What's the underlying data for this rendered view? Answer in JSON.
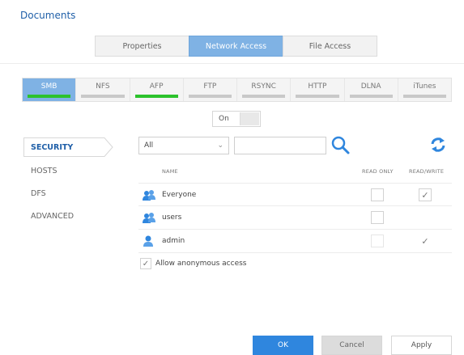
{
  "page": {
    "title": "Documents"
  },
  "main_tabs": [
    {
      "label": "Properties",
      "active": false
    },
    {
      "label": "Network Access",
      "active": true
    },
    {
      "label": "File Access",
      "active": false
    }
  ],
  "protocol_tabs": [
    {
      "label": "SMB",
      "active": true,
      "enabled": true
    },
    {
      "label": "NFS",
      "active": false,
      "enabled": false
    },
    {
      "label": "AFP",
      "active": false,
      "enabled": true
    },
    {
      "label": "FTP",
      "active": false,
      "enabled": false
    },
    {
      "label": "RSYNC",
      "active": false,
      "enabled": false
    },
    {
      "label": "HTTP",
      "active": false,
      "enabled": false
    },
    {
      "label": "DLNA",
      "active": false,
      "enabled": false
    },
    {
      "label": "iTunes",
      "active": false,
      "enabled": false
    }
  ],
  "toggle": {
    "label": "On"
  },
  "nav": {
    "security": "SECURITY",
    "hosts": "HOSTS",
    "dfs": "DFS",
    "advanced": "ADVANCED"
  },
  "filter": {
    "selected": "All",
    "search_value": ""
  },
  "table": {
    "headers": {
      "name": "NAME",
      "read_only": "READ ONLY",
      "read_write": "READ/WRITE"
    },
    "rows": [
      {
        "name": "Everyone",
        "icon": "group-icon",
        "read_only": false,
        "read_write": true
      },
      {
        "name": "users",
        "icon": "group-icon",
        "read_only": false,
        "read_write": false
      },
      {
        "name": "admin",
        "icon": "user-icon",
        "read_only": false,
        "read_write": true
      }
    ]
  },
  "anonymous": {
    "label": "Allow anonymous access",
    "checked": true
  },
  "buttons": {
    "ok": "OK",
    "cancel": "Cancel",
    "apply": "Apply"
  },
  "colors": {
    "accent": "#2f86de",
    "active_tab": "#7fb2e4",
    "enabled_bar": "#2cc22c",
    "title": "#1f5fa8"
  }
}
